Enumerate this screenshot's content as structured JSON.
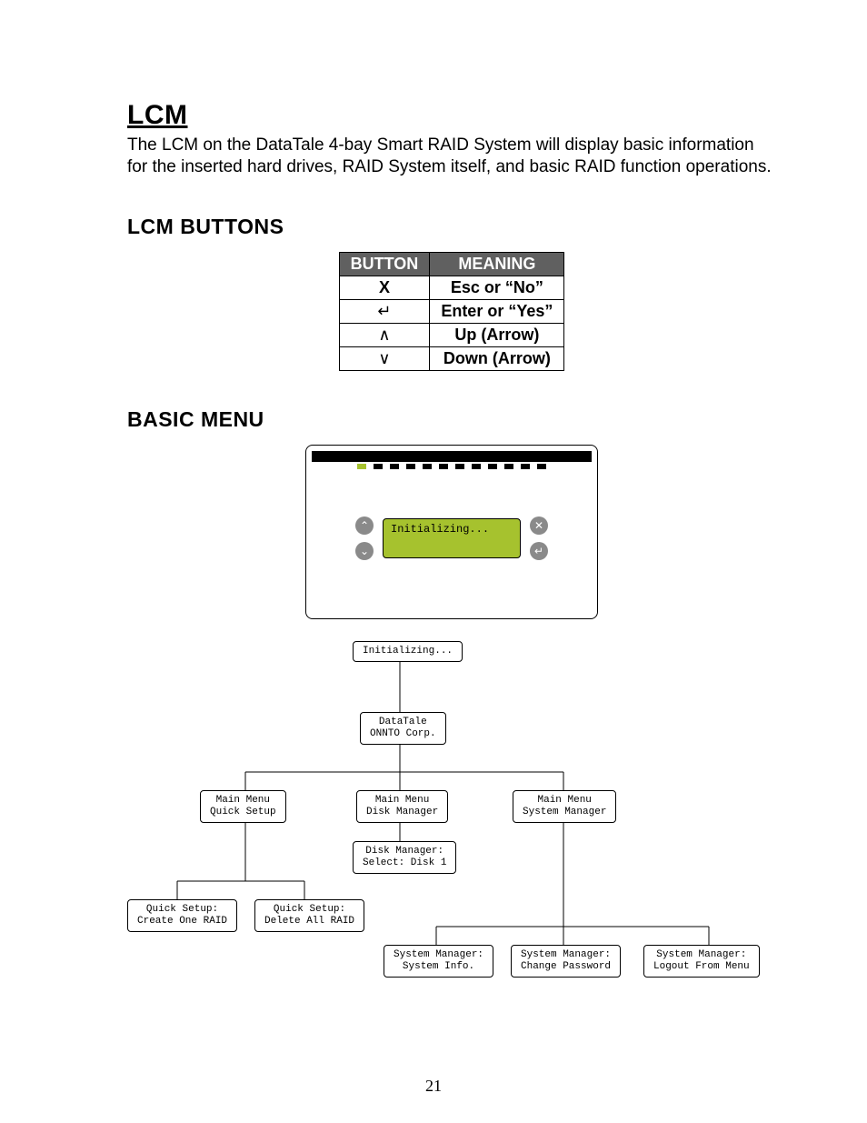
{
  "page_number": "21",
  "heading": "LCM",
  "intro": "The LCM on the DataTale 4-bay Smart RAID System will display basic information for the inserted hard drives, RAID System itself, and basic RAID function operations.",
  "section_buttons": "LCM BUTTONS",
  "table": {
    "header_button": "BUTTON",
    "header_meaning": "MEANING",
    "rows": [
      {
        "button": "X",
        "meaning": "Esc or “No”"
      },
      {
        "button": "↵",
        "meaning": "Enter or “Yes”"
      },
      {
        "button": "∧",
        "meaning": "Up (Arrow)"
      },
      {
        "button": "∨",
        "meaning": "Down (Arrow)"
      }
    ]
  },
  "section_basic": "BASIC MENU",
  "lcd_text": "Initializing...",
  "nav_icons": {
    "up": "⌃",
    "down": "⌄",
    "x": "✕",
    "enter": "↵"
  },
  "tree": {
    "n1": "Initializing...",
    "n2_l1": "DataTale",
    "n2_l2": "ONNTO Corp.",
    "m1_l1": "Main Menu",
    "m1_l2": "Quick Setup",
    "m2_l1": "Main Menu",
    "m2_l2": "Disk Manager",
    "m3_l1": "Main Menu",
    "m3_l2": "System Manager",
    "dm_l1": "Disk Manager:",
    "dm_l2": "Select: Disk 1",
    "qs1_l1": "Quick Setup:",
    "qs1_l2": "Create One RAID",
    "qs2_l1": "Quick Setup:",
    "qs2_l2": "Delete All RAID",
    "sm1_l1": "System Manager:",
    "sm1_l2": "System Info.",
    "sm2_l1": "System Manager:",
    "sm2_l2": "Change Password",
    "sm3_l1": "System Manager:",
    "sm3_l2": "Logout From Menu"
  }
}
